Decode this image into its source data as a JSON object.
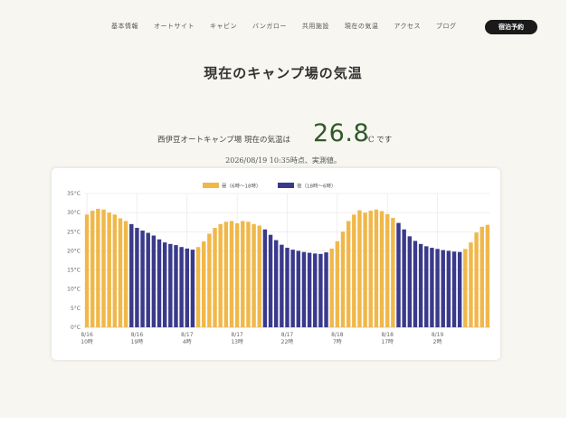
{
  "nav": {
    "items": [
      "基本情報",
      "オートサイト",
      "キャビン",
      "バンガロー",
      "共用施設",
      "現在の気温",
      "アクセス",
      "ブログ"
    ],
    "reserve_label": "宿泊予約"
  },
  "main": {
    "title": "現在のキャンプ場の気温",
    "temp_prefix": "西伊豆オートキャンプ場 現在の気温は",
    "temp_value": "26.8",
    "temp_suffix": "℃ です",
    "timestamp": "2026/08/19 10:35時点、実測値。"
  },
  "colors": {
    "day": "#f0b84a",
    "night": "#3a3a8c",
    "accent": "#2e5a2a",
    "button": "#1a1a1a"
  },
  "chart_data": {
    "type": "bar",
    "legend": [
      "昼（6時〜18時）",
      "夜（18時〜6時）"
    ],
    "legend_position": "top",
    "grid": true,
    "ylim": [
      0,
      35
    ],
    "yticks": [
      "0°C",
      "5°C",
      "10°C",
      "15°C",
      "20°C",
      "25°C",
      "30°C",
      "35°C"
    ],
    "xticks": [
      {
        "date": "8/16",
        "time": "10時"
      },
      {
        "date": "8/16",
        "time": "19時"
      },
      {
        "date": "8/17",
        "time": "4時"
      },
      {
        "date": "8/17",
        "time": "13時"
      },
      {
        "date": "8/17",
        "time": "22時"
      },
      {
        "date": "8/18",
        "time": "7時"
      },
      {
        "date": "8/18",
        "time": "17時"
      },
      {
        "date": "8/19",
        "time": "2時"
      }
    ],
    "hourly": [
      {
        "t": "8/16 10時",
        "v": 29.5,
        "p": "day"
      },
      {
        "t": "8/16 11時",
        "v": 30.5,
        "p": "day"
      },
      {
        "t": "8/16 12時",
        "v": 31.0,
        "p": "day"
      },
      {
        "t": "8/16 13時",
        "v": 30.8,
        "p": "day"
      },
      {
        "t": "8/16 14時",
        "v": 30.0,
        "p": "day"
      },
      {
        "t": "8/16 15時",
        "v": 29.5,
        "p": "day"
      },
      {
        "t": "8/16 16時",
        "v": 28.5,
        "p": "day"
      },
      {
        "t": "8/16 17時",
        "v": 27.8,
        "p": "day"
      },
      {
        "t": "8/16 18時",
        "v": 27.0,
        "p": "night"
      },
      {
        "t": "8/16 19時",
        "v": 26.0,
        "p": "night"
      },
      {
        "t": "8/16 20時",
        "v": 25.3,
        "p": "night"
      },
      {
        "t": "8/16 21時",
        "v": 24.7,
        "p": "night"
      },
      {
        "t": "8/16 22時",
        "v": 24.0,
        "p": "night"
      },
      {
        "t": "8/16 23時",
        "v": 23.0,
        "p": "night"
      },
      {
        "t": "8/17 0時",
        "v": 22.2,
        "p": "night"
      },
      {
        "t": "8/17 1時",
        "v": 21.8,
        "p": "night"
      },
      {
        "t": "8/17 2時",
        "v": 21.5,
        "p": "night"
      },
      {
        "t": "8/17 3時",
        "v": 21.0,
        "p": "night"
      },
      {
        "t": "8/17 4時",
        "v": 20.6,
        "p": "night"
      },
      {
        "t": "8/17 5時",
        "v": 20.3,
        "p": "night"
      },
      {
        "t": "8/17 6時",
        "v": 21.0,
        "p": "day"
      },
      {
        "t": "8/17 7時",
        "v": 22.5,
        "p": "day"
      },
      {
        "t": "8/17 8時",
        "v": 24.5,
        "p": "day"
      },
      {
        "t": "8/17 9時",
        "v": 26.0,
        "p": "day"
      },
      {
        "t": "8/17 10時",
        "v": 27.0,
        "p": "day"
      },
      {
        "t": "8/17 11時",
        "v": 27.6,
        "p": "day"
      },
      {
        "t": "8/17 12時",
        "v": 27.8,
        "p": "day"
      },
      {
        "t": "8/17 13時",
        "v": 27.2,
        "p": "day"
      },
      {
        "t": "8/17 14時",
        "v": 27.8,
        "p": "day"
      },
      {
        "t": "8/17 15时",
        "v": 27.6,
        "p": "day"
      },
      {
        "t": "8/17 16時",
        "v": 27.0,
        "p": "day"
      },
      {
        "t": "8/17 17時",
        "v": 26.6,
        "p": "day"
      },
      {
        "t": "8/17 18時",
        "v": 25.6,
        "p": "night"
      },
      {
        "t": "8/17 19時",
        "v": 24.2,
        "p": "night"
      },
      {
        "t": "8/17 20時",
        "v": 22.8,
        "p": "night"
      },
      {
        "t": "8/17 21時",
        "v": 21.6,
        "p": "night"
      },
      {
        "t": "8/17 22時",
        "v": 20.8,
        "p": "night"
      },
      {
        "t": "8/17 23時",
        "v": 20.3,
        "p": "night"
      },
      {
        "t": "8/18 0時",
        "v": 20.0,
        "p": "night"
      },
      {
        "t": "8/18 1時",
        "v": 19.7,
        "p": "night"
      },
      {
        "t": "8/18 2時",
        "v": 19.5,
        "p": "night"
      },
      {
        "t": "8/18 3時",
        "v": 19.3,
        "p": "night"
      },
      {
        "t": "8/18 4時",
        "v": 19.2,
        "p": "night"
      },
      {
        "t": "8/18 5時",
        "v": 19.6,
        "p": "night"
      },
      {
        "t": "8/18 6時",
        "v": 20.6,
        "p": "day"
      },
      {
        "t": "8/18 7時",
        "v": 22.5,
        "p": "day"
      },
      {
        "t": "8/18 8時",
        "v": 25.0,
        "p": "day"
      },
      {
        "t": "8/18 9時",
        "v": 27.8,
        "p": "day"
      },
      {
        "t": "8/18 10時",
        "v": 29.5,
        "p": "day"
      },
      {
        "t": "8/18 11時",
        "v": 30.6,
        "p": "day"
      },
      {
        "t": "8/18 12時",
        "v": 30.0,
        "p": "day"
      },
      {
        "t": "8/18 13時",
        "v": 30.5,
        "p": "day"
      },
      {
        "t": "8/18 14時",
        "v": 30.8,
        "p": "day"
      },
      {
        "t": "8/18 15時",
        "v": 30.4,
        "p": "day"
      },
      {
        "t": "8/18 16時",
        "v": 29.6,
        "p": "day"
      },
      {
        "t": "8/18 17時",
        "v": 28.6,
        "p": "day"
      },
      {
        "t": "8/18 18時",
        "v": 27.3,
        "p": "night"
      },
      {
        "t": "8/18 19時",
        "v": 25.6,
        "p": "night"
      },
      {
        "t": "8/18 20時",
        "v": 23.8,
        "p": "night"
      },
      {
        "t": "8/18 21時",
        "v": 22.6,
        "p": "night"
      },
      {
        "t": "8/18 22時",
        "v": 21.8,
        "p": "night"
      },
      {
        "t": "8/18 23時",
        "v": 21.2,
        "p": "night"
      },
      {
        "t": "8/19 0時",
        "v": 20.8,
        "p": "night"
      },
      {
        "t": "8/19 1時",
        "v": 20.5,
        "p": "night"
      },
      {
        "t": "8/19 2時",
        "v": 20.2,
        "p": "night"
      },
      {
        "t": "8/19 3時",
        "v": 20.0,
        "p": "night"
      },
      {
        "t": "8/19 4時",
        "v": 19.8,
        "p": "night"
      },
      {
        "t": "8/19 5時",
        "v": 19.7,
        "p": "night"
      },
      {
        "t": "8/19 6時",
        "v": 20.5,
        "p": "day"
      },
      {
        "t": "8/19 7時",
        "v": 22.2,
        "p": "day"
      },
      {
        "t": "8/19 8時",
        "v": 24.8,
        "p": "day"
      },
      {
        "t": "8/19 9時",
        "v": 26.3,
        "p": "day"
      },
      {
        "t": "8/19 10時",
        "v": 26.8,
        "p": "day"
      }
    ]
  }
}
